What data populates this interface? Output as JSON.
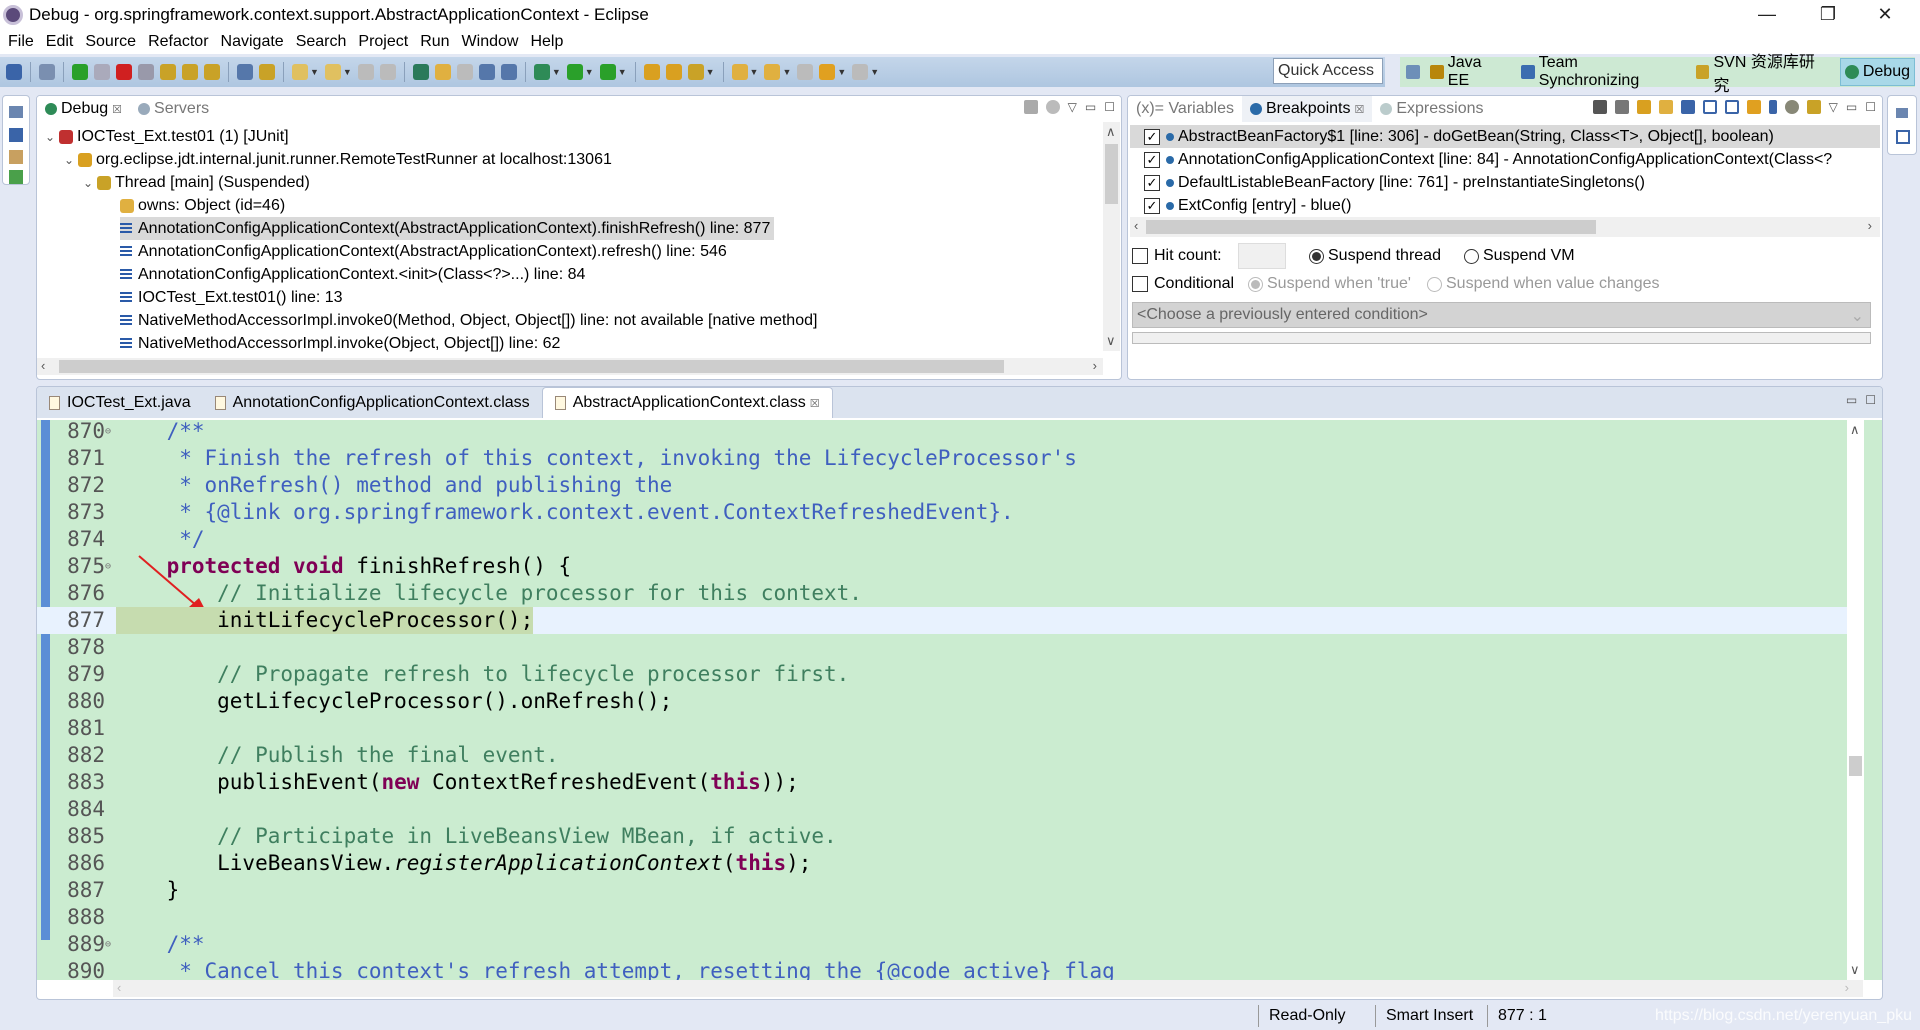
{
  "window": {
    "title": "Debug - org.springframework.context.support.AbstractApplicationContext - Eclipse",
    "minimize": "—",
    "restore": "❐",
    "close": "✕"
  },
  "menu": [
    "File",
    "Edit",
    "Source",
    "Refactor",
    "Navigate",
    "Search",
    "Project",
    "Run",
    "Window",
    "Help"
  ],
  "toolbar": {
    "quick_access": "Quick Access",
    "perspectives": [
      {
        "label": "Java EE",
        "color": "#b8860b"
      },
      {
        "label": "Team Synchronizing",
        "color": "#3b6db0"
      },
      {
        "label": "SVN 资源库研究",
        "color": "#c9a227"
      },
      {
        "label": "Debug",
        "color": "#2e8b57",
        "active": true
      }
    ]
  },
  "debug_view": {
    "tabs": [
      {
        "label": "Debug",
        "close": "☒",
        "active": true
      },
      {
        "label": "Servers"
      }
    ],
    "tree": [
      {
        "text": "IOCTest_Ext.test01 (1) [JUnit]",
        "level": 0,
        "twisty": "v",
        "icon": "junit-icon"
      },
      {
        "text": "org.eclipse.jdt.internal.junit.runner.RemoteTestRunner at localhost:13061",
        "level": 1,
        "twisty": "v",
        "icon": "vm-icon"
      },
      {
        "text": "Thread [main] (Suspended)",
        "level": 2,
        "twisty": "v",
        "icon": "thread-icon"
      },
      {
        "text": "owns: Object  (id=46)",
        "level": 3,
        "icon": "monitor-icon"
      },
      {
        "text": "AnnotationConfigApplicationContext(AbstractApplicationContext).finishRefresh() line: 877",
        "level": 3,
        "icon": "stack-frame-icon",
        "selected": true
      },
      {
        "text": "AnnotationConfigApplicationContext(AbstractApplicationContext).refresh() line: 546",
        "level": 3,
        "icon": "stack-frame-icon"
      },
      {
        "text": "AnnotationConfigApplicationContext.<init>(Class<?>...) line: 84",
        "level": 3,
        "icon": "stack-frame-icon"
      },
      {
        "text": "IOCTest_Ext.test01() line: 13",
        "level": 3,
        "icon": "stack-frame-icon"
      },
      {
        "text": "NativeMethodAccessorImpl.invoke0(Method, Object, Object[]) line: not available [native method]",
        "level": 3,
        "icon": "stack-frame-icon"
      },
      {
        "text": "NativeMethodAccessorImpl.invoke(Object, Object[]) line: 62",
        "level": 3,
        "icon": "stack-frame-icon"
      }
    ]
  },
  "breakpoints_view": {
    "tabs": [
      {
        "label": "(x)= Variables"
      },
      {
        "label": "Breakpoints",
        "close": "☒",
        "active": true
      },
      {
        "label": "Expressions"
      }
    ],
    "items": [
      {
        "text": "AbstractBeanFactory$1 [line: 306] - doGetBean(String, Class<T>, Object[], boolean)",
        "checked": true,
        "selected": true
      },
      {
        "text": "AnnotationConfigApplicationContext [line: 84] - AnnotationConfigApplicationContext(Class<?",
        "checked": true
      },
      {
        "text": "DefaultListableBeanFactory [line: 761] - preInstantiateSingletons()",
        "checked": true
      },
      {
        "text": "ExtConfig [entry] - blue()",
        "checked": true
      }
    ],
    "hit_count_label": "Hit count:",
    "hit_count_value": "",
    "suspend_thread": "Suspend thread",
    "suspend_vm": "Suspend VM",
    "suspend_selected": "Suspend thread",
    "conditional_label": "Conditional",
    "when_true": "Suspend when 'true'",
    "when_changes": "Suspend when value changes",
    "condition_placeholder": "<Choose a previously entered condition>"
  },
  "editor": {
    "tabs": [
      {
        "label": "IOCTest_Ext.java"
      },
      {
        "label": "AnnotationConfigApplicationContext.class"
      },
      {
        "label": "AbstractApplicationContext.class",
        "close": "☒",
        "active": true
      }
    ],
    "current_line": 877,
    "lines": [
      {
        "n": "870",
        "fold": true,
        "segs": [
          [
            "    ",
            ""
          ],
          [
            "/**",
            "cm"
          ]
        ]
      },
      {
        "n": "871",
        "segs": [
          [
            "     * Finish the refresh of this context, invoking the LifecycleProcessor's",
            "cm"
          ]
        ]
      },
      {
        "n": "872",
        "segs": [
          [
            "     * onRefresh() method and publishing the",
            "cm"
          ]
        ]
      },
      {
        "n": "873",
        "segs": [
          [
            "     * {@link org.springframework.context.event.ContextRefreshedEvent}.",
            "cm"
          ]
        ]
      },
      {
        "n": "874",
        "segs": [
          [
            "     */",
            "cm"
          ]
        ]
      },
      {
        "n": "875",
        "fold": true,
        "segs": [
          [
            "    ",
            ""
          ],
          [
            "protected",
            "k"
          ],
          [
            " ",
            ""
          ],
          [
            "void",
            "k"
          ],
          [
            " finishRefresh() {",
            ""
          ]
        ]
      },
      {
        "n": "876",
        "segs": [
          [
            "        // Initialize lifecycle processor for this context.",
            "c"
          ]
        ]
      },
      {
        "n": "877",
        "current": true,
        "segs": [
          [
            "        initLifecycleProcessor();",
            ""
          ]
        ]
      },
      {
        "n": "878",
        "segs": []
      },
      {
        "n": "879",
        "segs": [
          [
            "        // Propagate refresh to lifecycle processor first.",
            "c"
          ]
        ]
      },
      {
        "n": "880",
        "segs": [
          [
            "        getLifecycleProcessor().onRefresh();",
            ""
          ]
        ]
      },
      {
        "n": "881",
        "segs": []
      },
      {
        "n": "882",
        "segs": [
          [
            "        // Publish the final event.",
            "c"
          ]
        ]
      },
      {
        "n": "883",
        "segs": [
          [
            "        publishEvent(",
            ""
          ],
          [
            "new",
            "k"
          ],
          [
            " ContextRefreshedEvent(",
            ""
          ],
          [
            "this",
            "k"
          ],
          [
            "));",
            ""
          ]
        ]
      },
      {
        "n": "884",
        "segs": []
      },
      {
        "n": "885",
        "segs": [
          [
            "        // Participate in LiveBeansView MBean, if active.",
            "c"
          ]
        ]
      },
      {
        "n": "886",
        "segs": [
          [
            "        LiveBeansView.",
            ""
          ],
          [
            "registerApplicationContext",
            "i"
          ],
          [
            "(",
            ""
          ],
          [
            "this",
            "k"
          ],
          [
            ");",
            ""
          ]
        ]
      },
      {
        "n": "887",
        "segs": [
          [
            "    }",
            ""
          ]
        ]
      },
      {
        "n": "888",
        "segs": []
      },
      {
        "n": "889",
        "fold": true,
        "segs": [
          [
            "    ",
            ""
          ],
          [
            "/**",
            "cm"
          ]
        ]
      },
      {
        "n": "890",
        "segs": [
          [
            "     * Cancel this context's refresh attempt, resetting the {@code active} flag",
            "cm"
          ]
        ]
      }
    ]
  },
  "status": {
    "mode": "Read-Only",
    "insert": "Smart Insert",
    "position": "877 : 1",
    "watermark": "https://blog.csdn.net/yerenyuan_pku"
  }
}
